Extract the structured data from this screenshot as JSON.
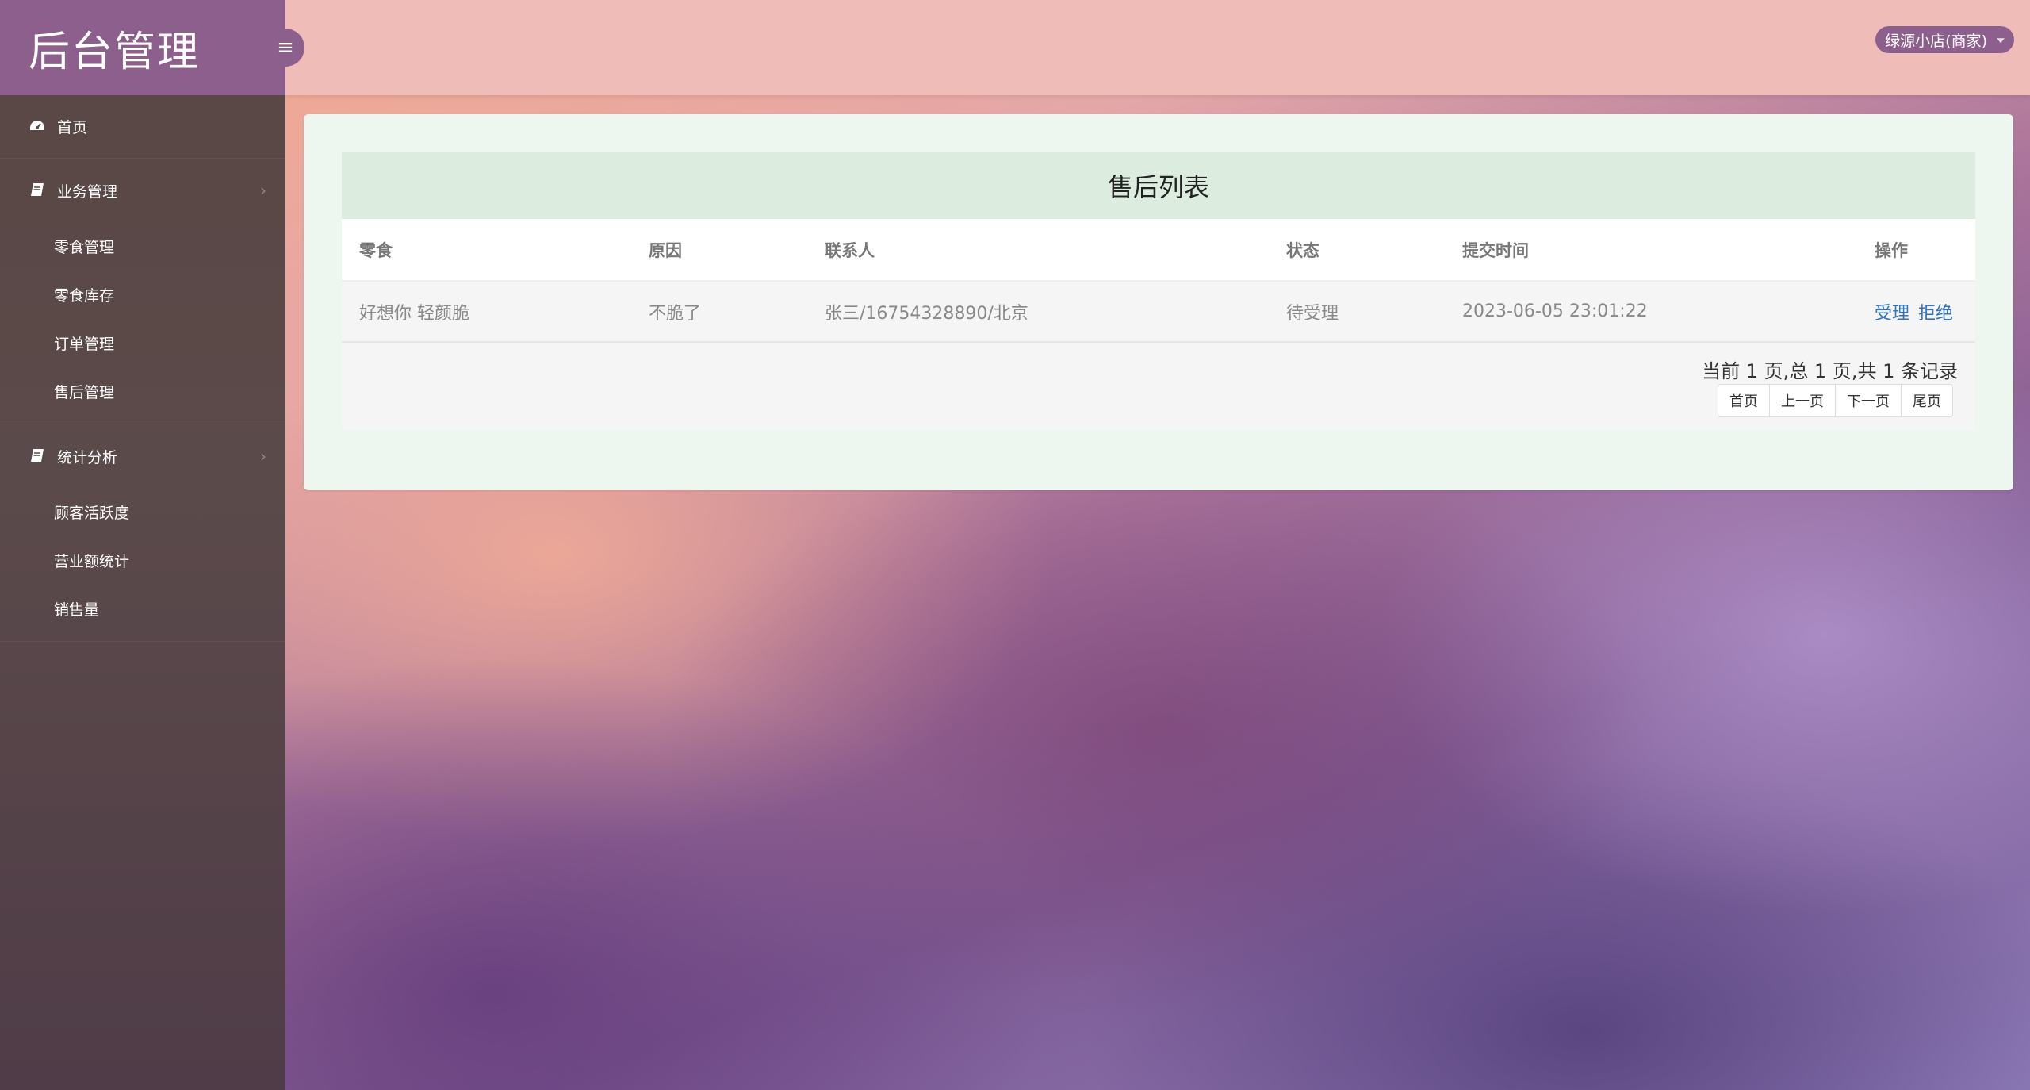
{
  "app": {
    "title": "后台管理"
  },
  "topbar": {
    "user_label": "绿源小店(商家)"
  },
  "sidebar": {
    "home_label": "首页",
    "groups": [
      {
        "label": "业务管理",
        "items": [
          "零食管理",
          "零食库存",
          "订单管理",
          "售后管理"
        ]
      },
      {
        "label": "统计分析",
        "items": [
          "顾客活跃度",
          "营业额统计",
          "销售量"
        ]
      }
    ]
  },
  "main": {
    "list_title": "售后列表",
    "columns": [
      "零食",
      "原因",
      "联系人",
      "状态",
      "提交时间",
      "操作"
    ],
    "rows": [
      {
        "food": "好想你 轻颜脆",
        "reason": "不脆了",
        "contact": "张三/16754328890/北京",
        "status": "待受理",
        "time": "2023-06-05 23:01:22",
        "actions": [
          "受理",
          "拒绝"
        ]
      }
    ],
    "pagination": {
      "summary": "当前 1 页,总 1 页,共 1 条记录",
      "first": "首页",
      "prev": "上一页",
      "next": "下一页",
      "last": "尾页"
    }
  },
  "colors": {
    "accent": "#8d5f8d",
    "topbar": "#f0bcb8",
    "link": "#2f72c4"
  },
  "icons": {
    "home": "dashboard-icon",
    "group": "book-icon",
    "toggle": "menu-icon"
  }
}
